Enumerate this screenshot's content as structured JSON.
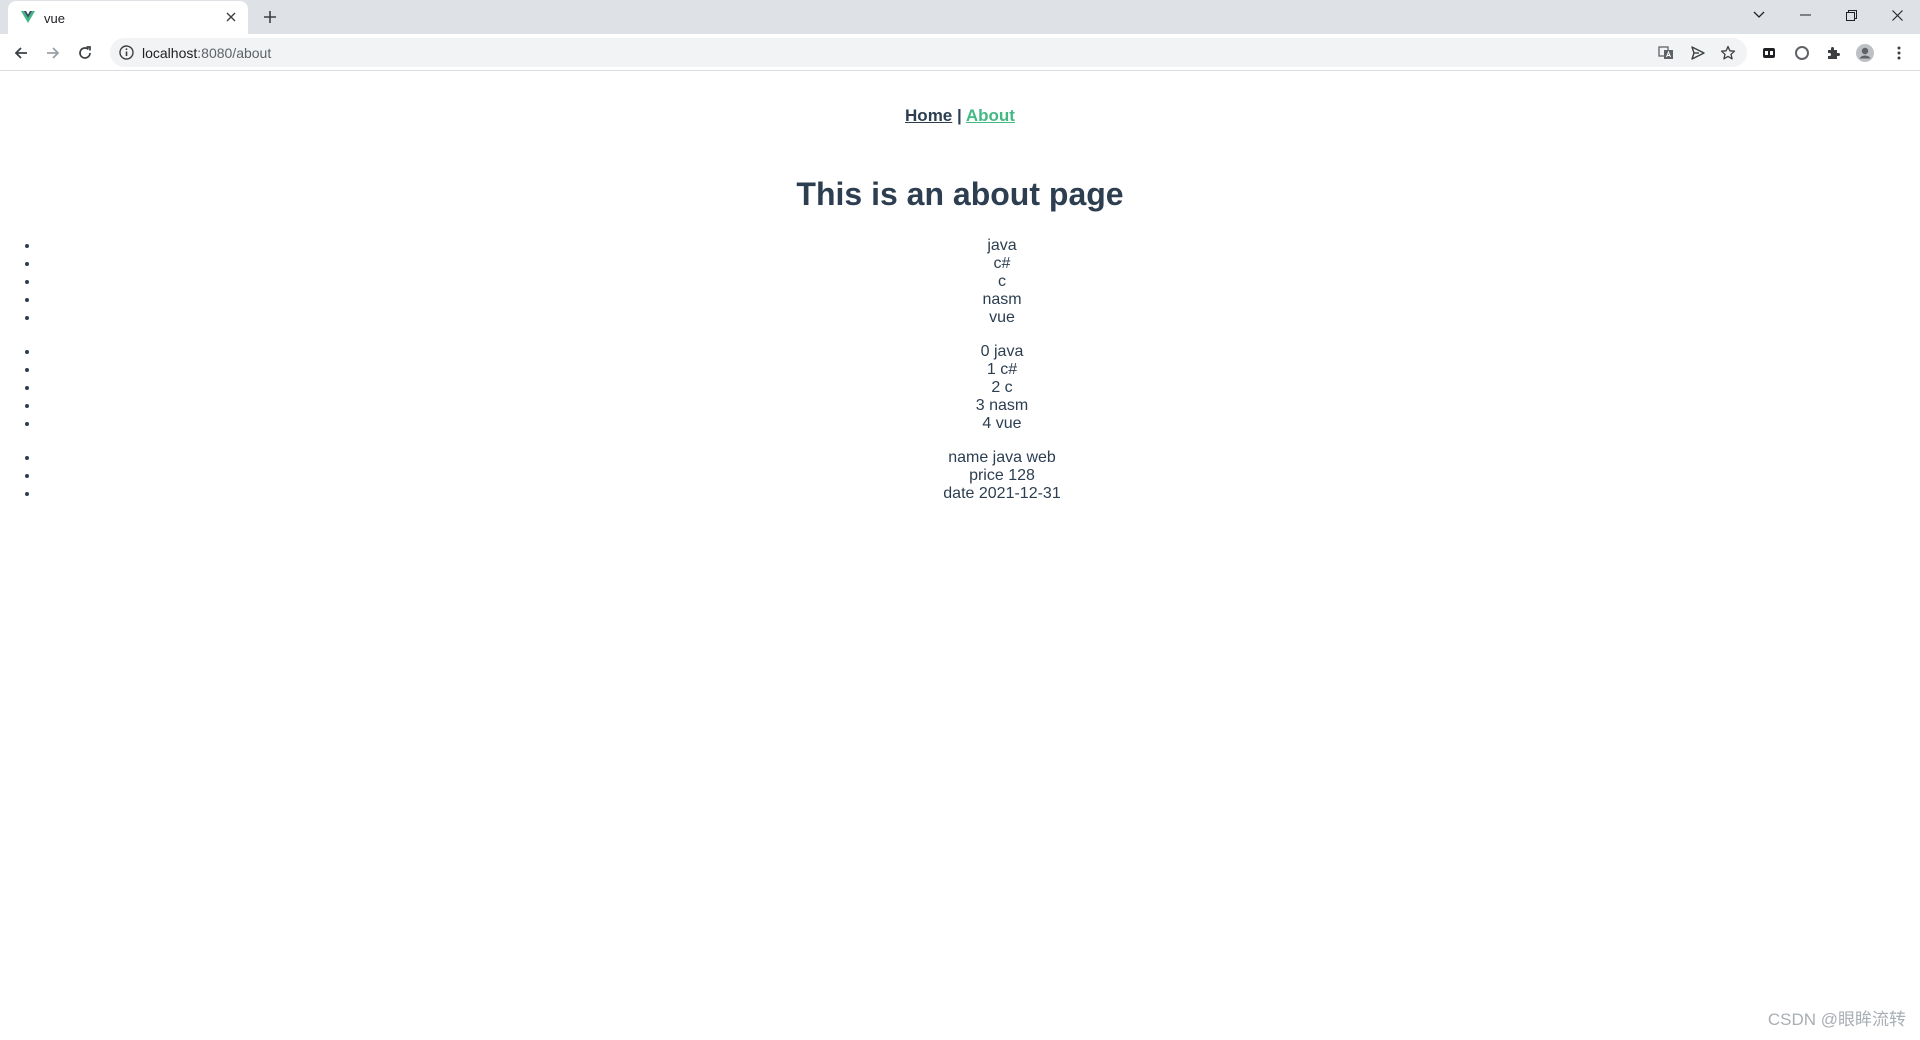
{
  "browser": {
    "tab": {
      "title": "vue"
    },
    "omnibox": {
      "host": "localhost",
      "rest": ":8080/about"
    }
  },
  "nav": {
    "home": "Home",
    "separator": "|",
    "about": "About"
  },
  "page": {
    "title": "This is an about page",
    "languages": [
      "java",
      "c#",
      "c",
      "nasm",
      "vue"
    ],
    "indexed_languages": [
      "0 java",
      "1 c#",
      "2 c",
      "3 nasm",
      "4 vue"
    ],
    "book": [
      "name java web",
      "price 128",
      "date 2021-12-31"
    ]
  },
  "watermark": "CSDN @眼眸流转",
  "colors": {
    "text": "#2c3e50",
    "active_link": "#42b983",
    "vue_green": "#41b883",
    "vue_dark": "#35495e"
  }
}
